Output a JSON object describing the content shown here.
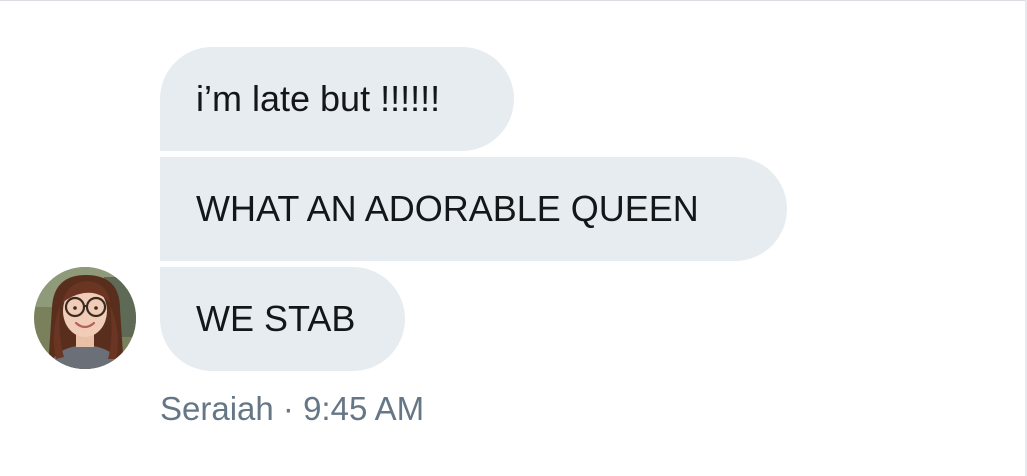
{
  "conversation": {
    "messages": [
      {
        "text": "i’m late but !!!!!!"
      },
      {
        "text": "WHAT AN ADORABLE QUEEN"
      },
      {
        "text": "WE STAB"
      }
    ],
    "sender": {
      "name": "Seraiah",
      "separator": " · ",
      "time": "9:45 AM",
      "avatar_icon": "user-avatar"
    }
  },
  "colors": {
    "bubble_background": "#e6ecf0",
    "message_text": "#14171a",
    "meta_text": "#657786"
  }
}
